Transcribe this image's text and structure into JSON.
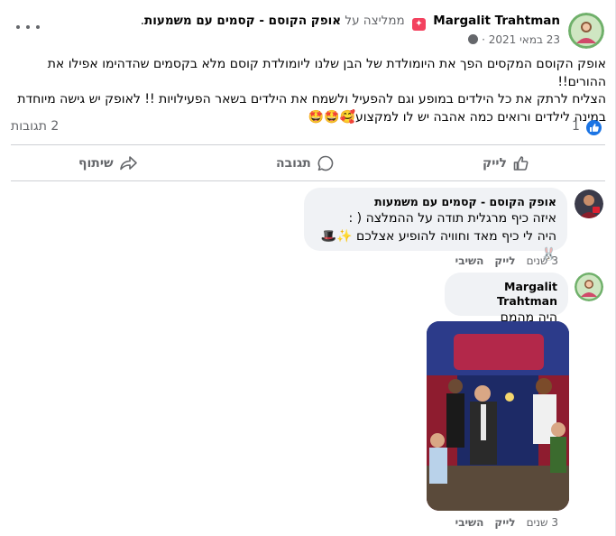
{
  "post": {
    "author": "Margalit Trahtman",
    "recommends": "ממליצה על",
    "page": "אופק הקוסם - קסמים עם משמעות",
    "period": ".",
    "date": "23 במאי 2021",
    "dot": "·",
    "text_line1": "אופק הקוסם המקסים הפך את היומולדת של הבן שלנו ליומולדת קוסם מלא בקסמים שהדהימו אפילו את ההורים!!",
    "text_line2": "הצליח לרתק את כל הילדים במופע וגם להפעיל ולשמח את הילדים בשאר הפעילויות !! לאופק יש גישה מיוחדת",
    "text_line3": "במינה לילדים ורואים כמה אהבה יש לו למקצוע🥰🤩🤩",
    "like_count": "1",
    "comments_count": "2 תגובות"
  },
  "actions": {
    "like": "לייק",
    "comment": "תגובה",
    "share": "שיתוף"
  },
  "comments": [
    {
      "author": "אופק הקוסם - קסמים עם משמעות",
      "line1": "איזה כיף מרגלית תודה על ההמלצה ( :",
      "line2": "היה לי כיף מאד וחוויה להופיע אצלכם ✨🎩🐰",
      "time": "3 שנים",
      "like": "לייק",
      "reply": "השיבי"
    },
    {
      "author": "Margalit Trahtman",
      "line1": "היה מהמם ❗❗❗",
      "time": "3 שנים",
      "like": "לייק",
      "reply": "השיבי"
    }
  ],
  "colors": {
    "accent": "#1b74e4",
    "muted": "#65676b",
    "bubble": "#f0f2f5",
    "badge": "#f3425f"
  }
}
